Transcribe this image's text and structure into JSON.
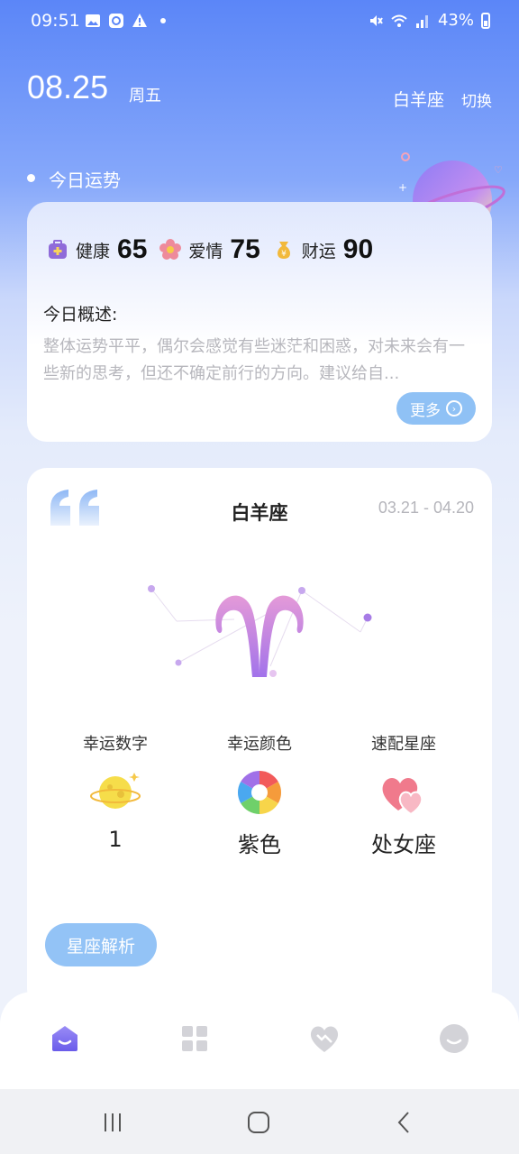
{
  "status_bar": {
    "time": "09:51",
    "battery": "43%",
    "icons": [
      "gallery-icon",
      "app-icon",
      "warning-icon",
      "dot-icon",
      "mute-icon",
      "wifi-icon",
      "signal-icon",
      "battery-icon"
    ]
  },
  "header": {
    "date": "08.25",
    "weekday": "周五",
    "sign": "白羊座",
    "switch_label": "切换"
  },
  "fortune": {
    "section_title": "今日运势",
    "stats": [
      {
        "label": "健康",
        "value": "65",
        "icon": "health-kit-icon",
        "color": "#8f6bd9"
      },
      {
        "label": "爱情",
        "value": "75",
        "icon": "flower-icon",
        "color": "#ee8a9b"
      },
      {
        "label": "财运",
        "value": "90",
        "icon": "money-bag-icon",
        "color": "#f2b93b"
      }
    ],
    "overview_label": "今日概述:",
    "overview_text": "整体运势平平，偶尔会感觉有些迷茫和困惑，对未来会有一些新的思考，但还不确定前行的方向。建议给自...",
    "more_label": "更多"
  },
  "sign_card": {
    "title": "白羊座",
    "date_range": "03.21 - 04.20",
    "lucky": [
      {
        "label": "幸运数字",
        "value": "1",
        "icon": "planet-icon"
      },
      {
        "label": "幸运颜色",
        "value": "紫色",
        "icon": "color-wheel-icon"
      },
      {
        "label": "速配星座",
        "value": "处女座",
        "icon": "hearts-icon"
      }
    ],
    "analysis_label": "星座解析"
  },
  "tabs": [
    "home-icon",
    "grid-icon",
    "heart-icon",
    "profile-icon"
  ],
  "colors": {
    "accent": "#5b86f8",
    "button": "#8fc1f5",
    "tab_active": "#7b6cf0"
  }
}
